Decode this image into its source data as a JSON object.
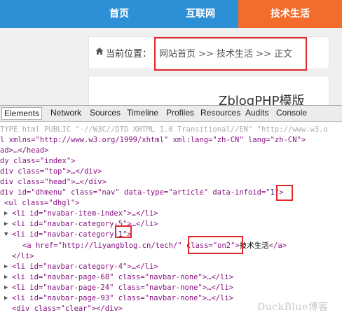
{
  "nav": {
    "items": [
      "首页",
      "互联网",
      "技术生活"
    ]
  },
  "breadcrumb": {
    "label": "当前位置：",
    "path": "网站首页 >> 技术生活 >> 正文"
  },
  "article": {
    "title_fragment": "ZblogPHP模版"
  },
  "devtools": {
    "tabs": [
      "Elements",
      "Network",
      "Sources",
      "Timeline",
      "Profiles",
      "Resources",
      "Audits",
      "Console"
    ]
  },
  "code": {
    "l1": "TYPE html PUBLIC \"-//W3C//DTD XHTML 1.0 Transitional//EN\" \"http://www.w3.o",
    "l2": "l xmlns=\"http://www.w3.org/1999/xhtml\" xml:lang=\"zh-CN\" lang=\"zh-CN\">",
    "l3": "ad>…</head>",
    "l4": "dy class=\"index\">",
    "l5": "div class=\"top\">…</div>",
    "l6": "div class=\"head\">…</div>",
    "l7a": "div id=\"dhmenu\" class=\"nav\" data-type=\"article\" data-infoid=\"",
    "l7b": "1",
    "l7c": "\">",
    "l8": "<ul class=\"dhgl\">",
    "l9": "<li id=\"nvabar-item-index\">…</li>",
    "l10": "<li id=\"navbar-category-5\">…</li>",
    "l11a": "<li id=\"navbar-category",
    "l11b": "-1",
    "l11c": "\">",
    "l12a": "<a href=\"http://liyangblog.cn/tech/\" ",
    "l12b": "class=\"on2\"",
    "l12c": ">",
    "l12d": "技术生活",
    "l12e": "</a>",
    "l13": "</li>",
    "l14": "<li id=\"navbar-category-4\">…</li>",
    "l15": "<li id=\"navbar-page-68\" class=\"navbar-none\">…</li>",
    "l16": "<li id=\"navbar-page-24\" class=\"navbar-none\">…</li>",
    "l17": "<li id=\"navbar-page-93\" class=\"navbar-none\">…</li>",
    "l18": "<div class=\"clear\"></div>"
  },
  "watermark": "DuckBlue博客",
  "colors": {
    "nav_bg": "#2d8fd5",
    "nav_active_bg": "#f26c2c",
    "highlight_border": "#e0282d"
  }
}
